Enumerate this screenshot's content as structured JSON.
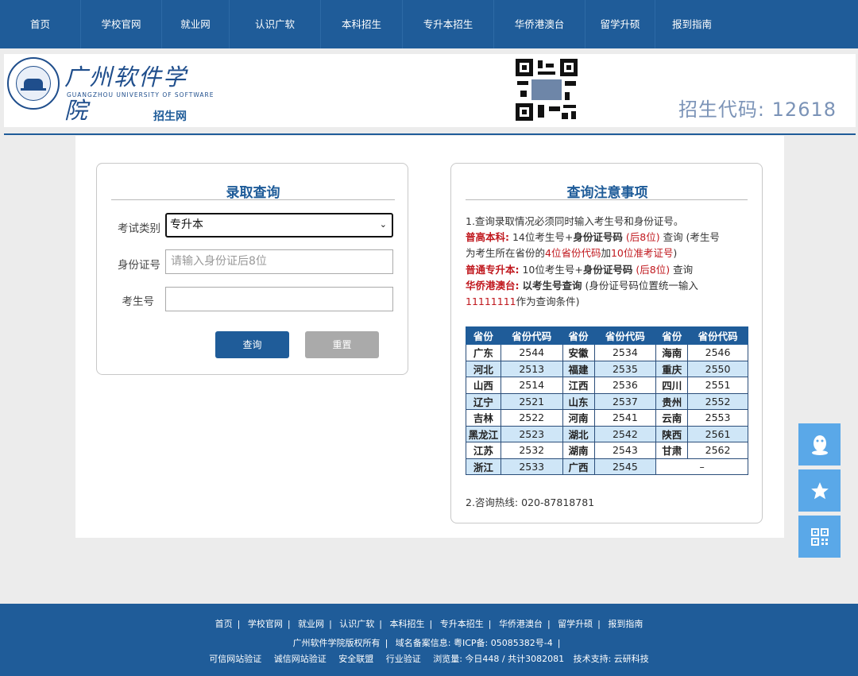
{
  "nav": [
    "首页",
    "学校官网",
    "就业网",
    "认识广软",
    "本科招生",
    "专升本招生",
    "华侨港澳台",
    "留学升硕",
    "报到指南"
  ],
  "header": {
    "school_name": "广州软件学院",
    "school_name_en": "GUANGZHOU UNIVERSITY OF SOFTWARE",
    "site_label": "招生网",
    "admission_code_label": "招生代码: 12618"
  },
  "query_panel": {
    "title": "录取查询",
    "exam_type_label": "考试类别",
    "exam_type_value": "专升本",
    "id_label": "身份证号",
    "id_placeholder": "请输入身份证后8位",
    "exam_no_label": "考生号",
    "exam_no_value": "",
    "query_button": "查询",
    "reset_button": "重置"
  },
  "notes_panel": {
    "title": "查询注意事项",
    "line1": "1.查询录取情况必须同时输入考生号和身份证号。",
    "line2": {
      "a": "普高本科:",
      "b": "14位考生号+",
      "c": "身份证号码",
      "d": "(后8位)",
      "e": "查询 (考生号"
    },
    "line3": {
      "a": "为考生所在省份的",
      "b": "4位省份代码",
      "c": "加",
      "d": "10位准考证号",
      "e": ")"
    },
    "line4": {
      "a": "普通专升本:",
      "b": "10位考生号+",
      "c": "身份证号码",
      "d": "(后8位)",
      "e": "查询"
    },
    "line5": {
      "a": "华侨港澳台:",
      "b": "以考生号查询",
      "c": "(身份证号码位置统一输入"
    },
    "line6": {
      "a": "11111111",
      "b": "作为查询条件)"
    },
    "table_headers": [
      "省份",
      "省份代码",
      "省份",
      "省份代码",
      "省份",
      "省份代码"
    ],
    "table_rows": [
      [
        "广东",
        "2544",
        "安徽",
        "2534",
        "海南",
        "2546"
      ],
      [
        "河北",
        "2513",
        "福建",
        "2535",
        "重庆",
        "2550"
      ],
      [
        "山西",
        "2514",
        "江西",
        "2536",
        "四川",
        "2551"
      ],
      [
        "辽宁",
        "2521",
        "山东",
        "2537",
        "贵州",
        "2552"
      ],
      [
        "吉林",
        "2522",
        "河南",
        "2541",
        "云南",
        "2553"
      ],
      [
        "黑龙江",
        "2523",
        "湖北",
        "2542",
        "陕西",
        "2561"
      ],
      [
        "江苏",
        "2532",
        "湖南",
        "2543",
        "甘肃",
        "2562"
      ],
      [
        "浙江",
        "2533",
        "广西",
        "2545",
        "–",
        ""
      ]
    ],
    "hotline": "2.咨询热线: 020-87818781"
  },
  "side_buttons": [
    "qq-icon",
    "star-icon",
    "qrcode-icon"
  ],
  "footer": {
    "links": [
      "首页",
      "学校官网",
      "就业网",
      "认识广软",
      "本科招生",
      "专升本招生",
      "华侨港澳台",
      "留学升硕",
      "报到指南"
    ],
    "copyright": "广州软件学院版权所有",
    "icp": "域名备案信息: 粤ICP备: 05085382号-4",
    "row3": [
      "可信网站验证",
      "诚信网站验证",
      "安全联盟",
      "行业验证",
      "浏览量: 今日448 / 共计3082081",
      "技术支持: 云研科技"
    ]
  },
  "colors": {
    "primary": "#1f5c99",
    "accent_red": "#c0181e",
    "side_button": "#5aa8e8",
    "table_alt": "#cfe6f7"
  }
}
